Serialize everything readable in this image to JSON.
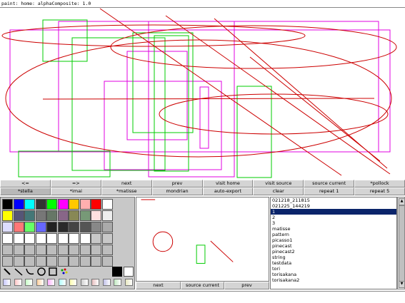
{
  "title": "paint: home: alphaComposite: 1.0",
  "nav_row1": [
    "<=",
    "=>",
    "next",
    "prev",
    "visit home",
    "visit source",
    "source current",
    "*pollock"
  ],
  "nav_row2": [
    "*stella",
    "*imai",
    "*matisse",
    "mondrian",
    "auto-export",
    "clear",
    "repeat 1",
    "repeat 5"
  ],
  "palette_colors": [
    [
      "#000000",
      "#0000ff",
      "#00ffff",
      "#333333",
      "#00ff00",
      "#ff00ff",
      "#ffc800",
      "#ffafaf",
      "#ff0000",
      "#ffffff"
    ],
    [
      "#ffff00",
      "#555577",
      "#447777",
      "#777777",
      "#667766",
      "#886688",
      "#888855",
      "#779977",
      "#ffe0e0",
      "#eeeeee"
    ],
    [
      "#ddddff",
      "#ff7777",
      "#66ff66",
      "#6666ff",
      "#222222",
      "#2a2a2a",
      "#444444",
      "#555555",
      "#888888",
      "#aaaaaa"
    ],
    [
      "#ffffff",
      "#ffffff",
      "#ffffff",
      "#ffffff",
      "#ffffff",
      "#ffffff",
      "#ffffff",
      "#ffffff",
      "#c8c8c8",
      "#c8c8c8"
    ]
  ],
  "tools": [
    "pencil-icon",
    "line-icon",
    "curve-icon",
    "ellipse-icon",
    "rectangle-icon",
    "spray-icon"
  ],
  "preview_buttons": [
    "next",
    "source current",
    "prev"
  ],
  "files": [
    "021218_211815",
    "021225_144219",
    "1",
    "2",
    "3",
    "matisse",
    "pattern",
    "picasso1",
    "pinecast",
    "pinecast2",
    "string",
    "testdata",
    "tori",
    "torisakana",
    "torisakana2"
  ],
  "selected_file": "1",
  "colors": {
    "accent_red": "#cc0000",
    "accent_magenta": "#e000e0",
    "accent_green": "#00cc00",
    "selection": "#0a246a"
  }
}
